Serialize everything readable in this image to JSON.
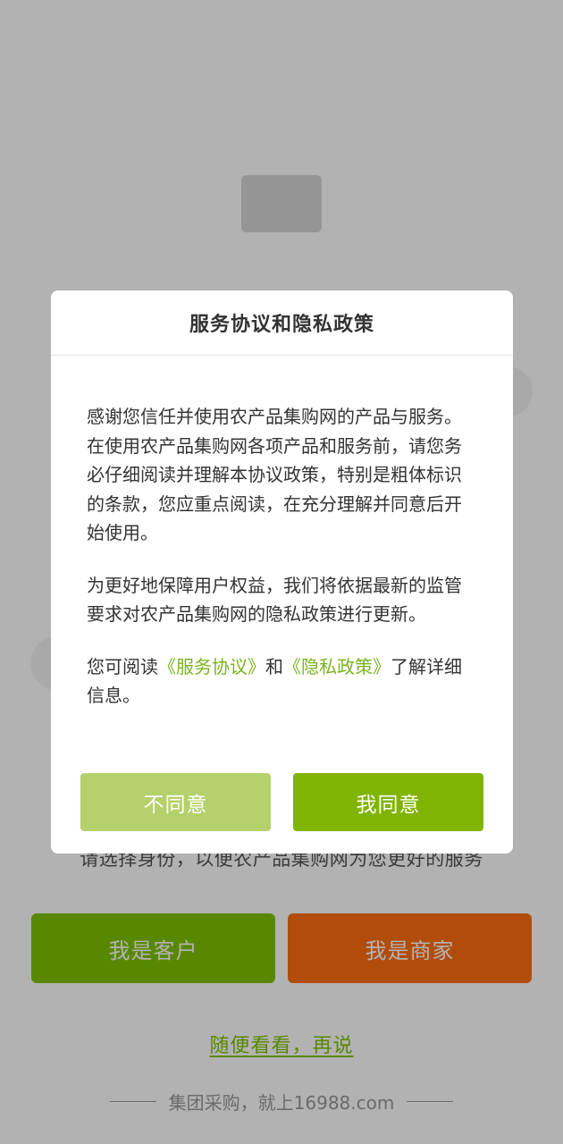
{
  "background": {
    "role_prompt": "请选择身份，以便农产品集购网为您更好的服务",
    "customer_button": "我是客户",
    "merchant_button": "我是商家",
    "browse_link": "随便看看，再说",
    "slogan": "集团采购，就上16988.com"
  },
  "dialog": {
    "title": "服务协议和隐私政策",
    "paragraph1": "感谢您信任并使用农产品集购网的产品与服务。在使用农产品集购网各项产品和服务前，请您务必仔细阅读并理解本协议政策，特别是粗体标识的条款，您应重点阅读，在充分理解并同意后开始使用。",
    "paragraph2": "为更好地保障用户权益，我们将依据最新的监管要求对农产品集购网的隐私政策进行更新。",
    "read_prefix": "您可阅读",
    "service_agreement_link": "《服务协议》",
    "conjunction": "和",
    "privacy_policy_link": "《隐私政策》",
    "read_suffix": "了解详细信息。",
    "disagree_button": "不同意",
    "agree_button": "我同意"
  },
  "colors": {
    "brand_green": "#7ec300",
    "brand_orange": "#ff6d10",
    "agree_button": "#80b402",
    "disagree_button": "#b5d16c",
    "link": "#7ab31e"
  }
}
